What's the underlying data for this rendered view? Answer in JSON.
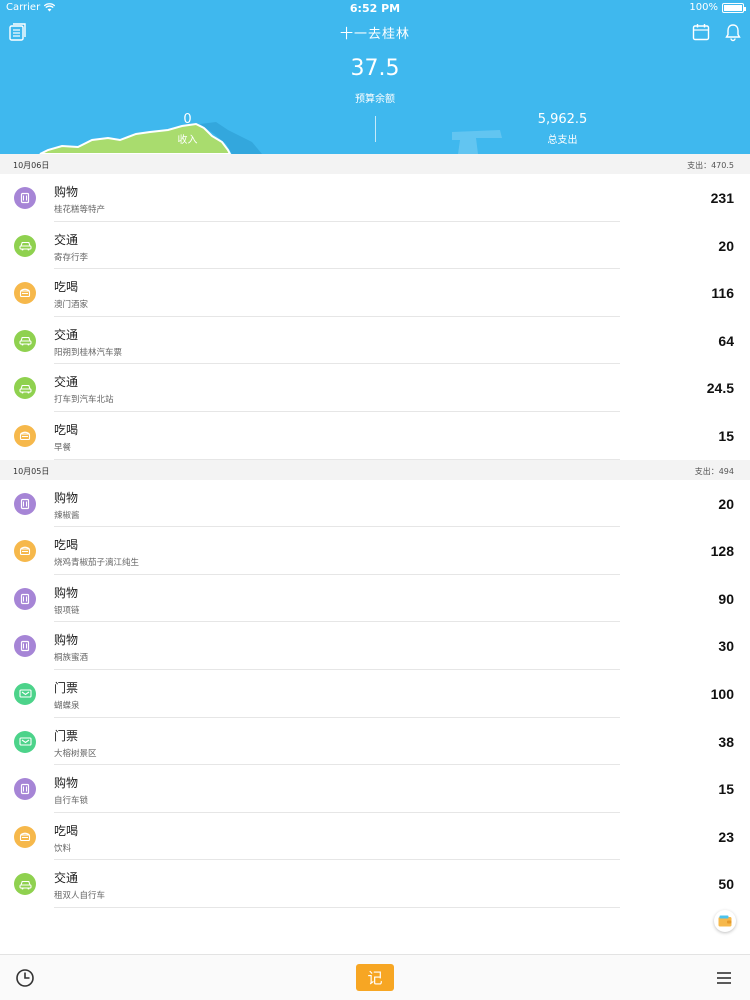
{
  "status_bar": {
    "carrier": "Carrier",
    "time": "6:52 PM",
    "battery": "100%"
  },
  "header": {
    "title": "十一去桂林",
    "balance": "37.5",
    "balance_label": "预算余额",
    "income_value": "0",
    "income_label": "收入",
    "expense_value": "5,962.5",
    "expense_label": "总支出"
  },
  "sections": [
    {
      "date": "10月06日",
      "spent": "支出：470.5",
      "rows": [
        {
          "category": "购物",
          "note": "桂花糕等特产",
          "amount": "231",
          "type": "shop"
        },
        {
          "category": "交通",
          "note": "寄存行李",
          "amount": "20",
          "type": "trans"
        },
        {
          "category": "吃喝",
          "note": "澳门酒家",
          "amount": "116",
          "type": "food"
        },
        {
          "category": "交通",
          "note": "阳朔到桂林汽车票",
          "amount": "64",
          "type": "trans"
        },
        {
          "category": "交通",
          "note": "打车到汽车北站",
          "amount": "24.5",
          "type": "trans"
        },
        {
          "category": "吃喝",
          "note": "早餐",
          "amount": "15",
          "type": "food"
        }
      ]
    },
    {
      "date": "10月05日",
      "spent": "支出：494",
      "rows": [
        {
          "category": "购物",
          "note": "辣椒酱",
          "amount": "20",
          "type": "shop"
        },
        {
          "category": "吃喝",
          "note": "烧鸡青椒茄子漓江纯生",
          "amount": "128",
          "type": "food"
        },
        {
          "category": "购物",
          "note": "银项链",
          "amount": "90",
          "type": "shop"
        },
        {
          "category": "购物",
          "note": "桐族蜜酒",
          "amount": "30",
          "type": "shop"
        },
        {
          "category": "门票",
          "note": "蝴蝶泉",
          "amount": "100",
          "type": "ticket"
        },
        {
          "category": "门票",
          "note": "大榕树景区",
          "amount": "38",
          "type": "ticket"
        },
        {
          "category": "购物",
          "note": "自行车锁",
          "amount": "15",
          "type": "shop"
        },
        {
          "category": "吃喝",
          "note": "饮料",
          "amount": "23",
          "type": "food"
        },
        {
          "category": "交通",
          "note": "租双人自行车",
          "amount": "50",
          "type": "trans"
        }
      ]
    }
  ],
  "bottom_bar": {
    "record_label": "记"
  },
  "colors": {
    "header": "#3fb8ee",
    "shop": "#a685d6",
    "trans": "#8fd14f",
    "food": "#f6b84b",
    "ticket": "#4cd38a",
    "record": "#f7a623"
  },
  "icons": {
    "shop": "shopping-bag-icon",
    "trans": "car-icon",
    "food": "food-box-icon",
    "ticket": "ticket-icon"
  }
}
